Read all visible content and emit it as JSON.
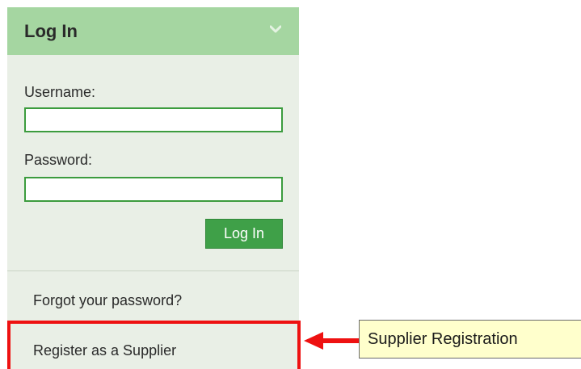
{
  "login_panel": {
    "title": "Log In",
    "collapse_icon": "chevron-down-icon",
    "username_label": "Username:",
    "username_value": "",
    "password_label": "Password:",
    "password_value": "",
    "login_button_label": "Log In",
    "forgot_password_link": "Forgot your password?",
    "register_link": "Register as a Supplier"
  },
  "annotation": {
    "callout_text": "Supplier Registration",
    "arrow_icon": "arrow-left-icon",
    "highlight_color": "#ee1111"
  },
  "colors": {
    "header_bg": "#a5d6a1",
    "panel_bg": "#e9efe6",
    "accent_green": "#3fa048",
    "callout_bg": "#ffffcc"
  }
}
